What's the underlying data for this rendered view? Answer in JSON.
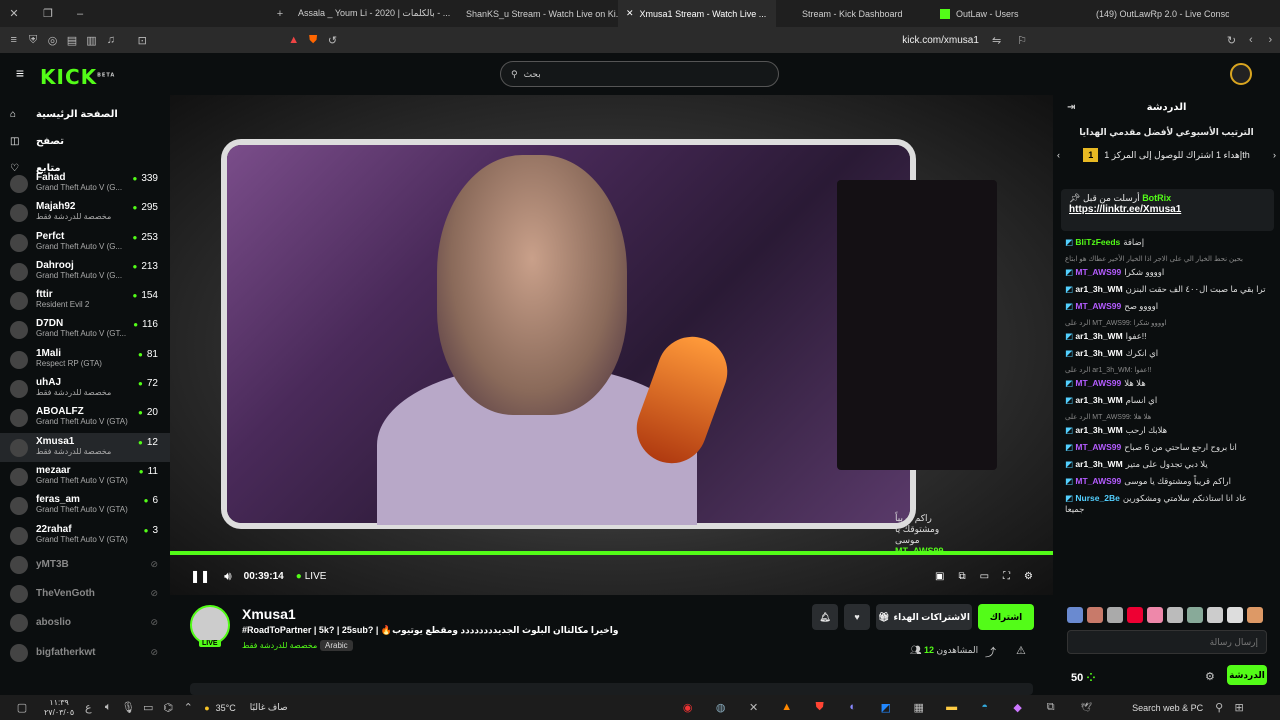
{
  "browser": {
    "tabs": [
      {
        "label": "Assala _ Youm Li - 2020 | بالكلمات - ..."
      },
      {
        "label": "ShanKS_u Stream - Watch Live on Ki..."
      },
      {
        "label": "Xmusa1 Stream - Watch Live ..."
      },
      {
        "label": "Stream - Kick Dashboard"
      },
      {
        "label": "OutLaw - Users"
      },
      {
        "label": "(149) OutLawRp 2.0 - Live Console"
      }
    ],
    "url": "kick.com/xmusa1"
  },
  "site": {
    "logo": "KICK",
    "logo_badge": "BETA",
    "search_placeholder": "بحث"
  },
  "sidebar": {
    "nav": [
      {
        "label": "الصفحة الرئيسية",
        "icon": "home-icon"
      },
      {
        "label": "تصفح",
        "icon": "browse-icon"
      },
      {
        "label": "متابع",
        "icon": "following-icon"
      }
    ],
    "channels": [
      {
        "name": "Fahad",
        "category": "Grand Theft Auto V (G...",
        "viewers": "339"
      },
      {
        "name": "Majah92",
        "category": "مخصصة للدردشة فقط",
        "viewers": "295"
      },
      {
        "name": "Perfct",
        "category": "Grand Theft Auto V (G...",
        "viewers": "253"
      },
      {
        "name": "Dahrooj",
        "category": "Grand Theft Auto V (G...",
        "viewers": "213"
      },
      {
        "name": "fttir",
        "category": "Resident Evil 2",
        "viewers": "154"
      },
      {
        "name": "D7DN",
        "category": "Grand Theft Auto V (GT...",
        "viewers": "116"
      },
      {
        "name": "1Mali",
        "category": "Respect RP (GTA)",
        "viewers": "81"
      },
      {
        "name": "uhAJ",
        "category": "مخصصة للدردشة فقط",
        "viewers": "72"
      },
      {
        "name": "ABOALFZ",
        "category": "Grand Theft Auto V (GTA)",
        "viewers": "20"
      },
      {
        "name": "Xmusa1",
        "category": "مخصصة للدردشة فقط",
        "viewers": "12"
      },
      {
        "name": "mezaar",
        "category": "Grand Theft Auto V (GTA)",
        "viewers": "11"
      },
      {
        "name": "feras_am",
        "category": "Grand Theft Auto V (GTA)",
        "viewers": "6"
      },
      {
        "name": "22rahaf",
        "category": "Grand Theft Auto V (GTA)",
        "viewers": "3"
      }
    ],
    "offline": [
      "yMT3B",
      "TheVenGoth",
      "aboslio",
      "bigfatherkwt"
    ]
  },
  "player": {
    "overlay_user": "MT_AWS99",
    "overlay_text": "راكم قريباً ومشتوقك يا موسى",
    "elapsed": "00:39:14",
    "live_label": "LIVE"
  },
  "channel": {
    "name": "Xmusa1",
    "title": "#RoadToPartner | 5k? | 25sub? | 🔥واخيرا مكالتاان البلوث الجديدددددددد ومقطع يوتيوب",
    "category": "مخصصة للدردشة فقط",
    "tag": "Arabic",
    "live_badge": "LIVE",
    "subscribe_label": "اشتراك",
    "gift_label": "الاشتراكات الهداء",
    "viewers_label": "المشاهدون",
    "viewers_count": "12"
  },
  "chat": {
    "title": "الدردشة",
    "leaderboard_title": "الترتيب الأسبوعي لأفضل مقدمي الهدايا",
    "leaderboard_rank": "1",
    "leaderboard_text": "إهداء 1 اشتراك للوصول إلى المركز 1th",
    "pinned_by": "أرسلت من قبل",
    "pinned_user": "BotRix",
    "pinned_link": "https://linktr.ee/Xmusa1",
    "messages": [
      {
        "user": "BliTzFeeds",
        "color": "#53fc18",
        "text": "إضافة",
        "reply": ""
      },
      {
        "user": "MT_AWS99",
        "color": "#b45cff",
        "text": "اوووو شكرا",
        "reply": "بحين نحط الخيار الي على الاجر اذا الخيار الأخير عطاك هو ابتاع"
      },
      {
        "user": "ar1_3h_WM",
        "color": "#ffffff",
        "text": "ترا بقي ما صبت ال٤٠٠ الف حقت البنزن",
        "reply": ""
      },
      {
        "user": "MT_AWS99",
        "color": "#b45cff",
        "text": "اوووو صح",
        "reply": ""
      },
      {
        "user": "ar1_3h_WM",
        "color": "#ffffff",
        "text": "عفوا!!",
        "reply": "الرد على MT_AWS99: اوووو شكرا"
      },
      {
        "user": "ar1_3h_WM",
        "color": "#ffffff",
        "text": "اي انكرك",
        "reply": ""
      },
      {
        "user": "MT_AWS99",
        "color": "#b45cff",
        "text": "هلا هلا",
        "reply": "الرد على ar1_3h_WM: عفوا!!"
      },
      {
        "user": "ar1_3h_WM",
        "color": "#ffffff",
        "text": "اي انسام",
        "reply": ""
      },
      {
        "user": "ar1_3h_WM",
        "color": "#ffffff",
        "text": "هلابك ارحب",
        "reply": "الرد على MT_AWS99: هلا هلا"
      },
      {
        "user": "MT_AWS99",
        "color": "#b45cff",
        "text": "انا بروح ارجع ساحتي من 6 صباح",
        "reply": ""
      },
      {
        "user": "ar1_3h_WM",
        "color": "#ffffff",
        "text": "يلا دبي تجدول على متير",
        "reply": ""
      },
      {
        "user": "MT_AWS99",
        "color": "#b45cff",
        "text": "اراكم قريباً ومشتوقك يا موسى",
        "reply": ""
      },
      {
        "user": "Nurse_2Be",
        "color": "#53d0ff",
        "text": "عاد انا استاذنكم سلامتي ومشكورين جميعا",
        "reply": ""
      }
    ],
    "input_placeholder": "إرسال رسالة",
    "points": "50",
    "chat_button": "الدردشة"
  },
  "taskbar": {
    "weather_temp": "35°C",
    "weather_text": "صاف غالبًا",
    "time": "١١:٣٩",
    "date": "٢٧/٠٣/٠٥",
    "search_label": "Search web & PC"
  },
  "colors": {
    "accent": "#53fc18",
    "bg": "#0b0e0f"
  }
}
